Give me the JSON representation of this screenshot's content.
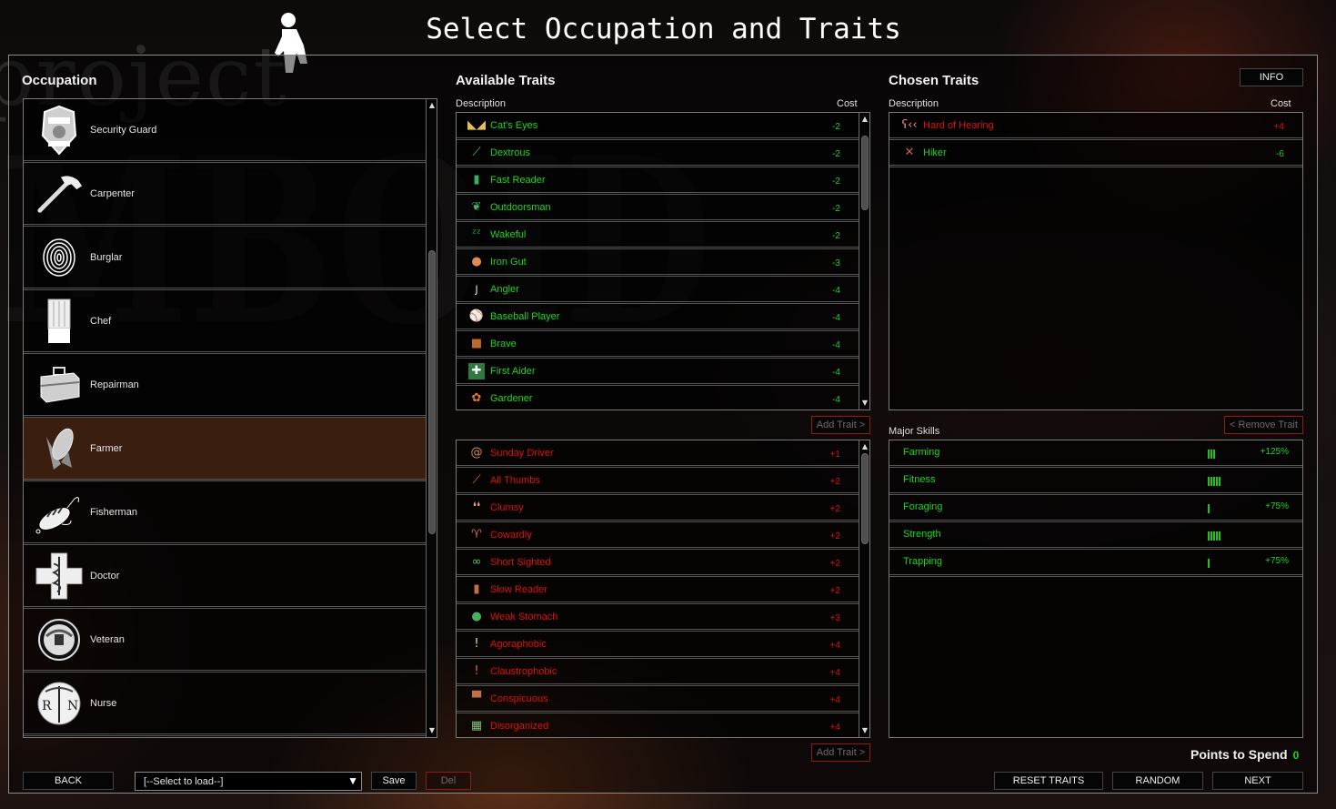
{
  "title": "Select Occupation and Traits",
  "background": {
    "logo_word1": "project",
    "logo_word2": "MBOID"
  },
  "occupation": {
    "heading": "Occupation",
    "selected": "Farmer",
    "items": [
      {
        "label": "Security Guard",
        "icon": "security-badge-icon"
      },
      {
        "label": "Carpenter",
        "icon": "hammer-icon"
      },
      {
        "label": "Burglar",
        "icon": "fingerprint-icon"
      },
      {
        "label": "Chef",
        "icon": "chef-hat-icon"
      },
      {
        "label": "Repairman",
        "icon": "toolbox-icon"
      },
      {
        "label": "Farmer",
        "icon": "corn-icon"
      },
      {
        "label": "Fisherman",
        "icon": "fishing-lure-icon"
      },
      {
        "label": "Doctor",
        "icon": "medical-cross-icon"
      },
      {
        "label": "Veteran",
        "icon": "veteran-seal-icon"
      },
      {
        "label": "Nurse",
        "icon": "nurse-caduceus-icon"
      }
    ]
  },
  "available_traits": {
    "heading": "Available Traits",
    "col_description": "Description",
    "col_cost": "Cost",
    "positive": [
      {
        "name": "Cat's Eyes",
        "cost": "-2",
        "icon": "cat-eyes-icon",
        "glyph": "◣◢"
      },
      {
        "name": "Dextrous",
        "cost": "-2",
        "icon": "needle-thread-icon",
        "glyph": "⟋"
      },
      {
        "name": "Fast Reader",
        "cost": "-2",
        "icon": "green-book-icon",
        "glyph": "▮"
      },
      {
        "name": "Outdoorsman",
        "cost": "-2",
        "icon": "leaf-icon",
        "glyph": "❦"
      },
      {
        "name": "Wakeful",
        "cost": "-2",
        "icon": "sleep-z-icon",
        "glyph": "ᶻᶻ"
      },
      {
        "name": "Iron Gut",
        "cost": "-3",
        "icon": "stomach-icon",
        "glyph": "●"
      },
      {
        "name": "Angler",
        "cost": "-4",
        "icon": "fish-hook-icon",
        "glyph": "ȷ"
      },
      {
        "name": "Baseball Player",
        "cost": "-4",
        "icon": "baseball-icon",
        "glyph": "⚾"
      },
      {
        "name": "Brave",
        "cost": "-4",
        "icon": "lion-icon",
        "glyph": "■"
      },
      {
        "name": "First Aider",
        "cost": "-4",
        "icon": "first-aid-icon",
        "glyph": "✚"
      },
      {
        "name": "Gardener",
        "cost": "-4",
        "icon": "flower-icon",
        "glyph": "✿"
      }
    ],
    "negative": [
      {
        "name": "Sunday Driver",
        "cost": "+1",
        "icon": "snail-icon",
        "glyph": "@"
      },
      {
        "name": "All Thumbs",
        "cost": "+2",
        "icon": "tangled-needle-icon",
        "glyph": "⟋"
      },
      {
        "name": "Clumsy",
        "cost": "+2",
        "icon": "footprints-icon",
        "glyph": "❛❛"
      },
      {
        "name": "Cowardly",
        "cost": "+2",
        "icon": "wilted-flower-icon",
        "glyph": "♈"
      },
      {
        "name": "Short Sighted",
        "cost": "+2",
        "icon": "glasses-icon",
        "glyph": "∞"
      },
      {
        "name": "Slow Reader",
        "cost": "+2",
        "icon": "brown-book-icon",
        "glyph": "▮"
      },
      {
        "name": "Weak Stomach",
        "cost": "+3",
        "icon": "sick-stomach-icon",
        "glyph": "●"
      },
      {
        "name": "Agoraphobic",
        "cost": "+4",
        "icon": "agoraphobia-icon",
        "glyph": "!"
      },
      {
        "name": "Claustrophobic",
        "cost": "+4",
        "icon": "claustrophobia-icon",
        "glyph": "!"
      },
      {
        "name": "Conspicuous",
        "cost": "+4",
        "icon": "top-hat-icon",
        "glyph": "▀"
      },
      {
        "name": "Disorganized",
        "cost": "+4",
        "icon": "mess-icon",
        "glyph": "▦"
      }
    ],
    "add_trait_label": "Add Trait >"
  },
  "chosen_traits": {
    "heading": "Chosen Traits",
    "info_label": "INFO",
    "col_description": "Description",
    "col_cost": "Cost",
    "items": [
      {
        "name": "Hard of Hearing",
        "cost": "+4",
        "type": "bad",
        "icon": "ear-icon",
        "glyph": "ʕ‹‹"
      },
      {
        "name": "Hiker",
        "cost": "-6",
        "type": "good",
        "icon": "walking-stick-icon",
        "glyph": "✕"
      }
    ],
    "remove_trait_label": "< Remove Trait"
  },
  "major_skills": {
    "heading": "Major Skills",
    "items": [
      {
        "name": "Farming",
        "level": 3,
        "bonus": "+125%"
      },
      {
        "name": "Fitness",
        "level": 5,
        "bonus": ""
      },
      {
        "name": "Foraging",
        "level": 1,
        "bonus": "+75%"
      },
      {
        "name": "Strength",
        "level": 5,
        "bonus": ""
      },
      {
        "name": "Trapping",
        "level": 1,
        "bonus": "+75%"
      }
    ]
  },
  "points": {
    "label": "Points to Spend",
    "value": "0"
  },
  "footer": {
    "back_label": "BACK",
    "load_placeholder": "[--Select to load--]",
    "save_label": "Save",
    "del_label": "Del",
    "reset_label": "RESET TRAITS",
    "random_label": "RANDOM",
    "next_label": "NEXT"
  },
  "colors": {
    "good": "#1fd61f",
    "bad": "#e01010",
    "selected_row": "#3a1f10"
  }
}
